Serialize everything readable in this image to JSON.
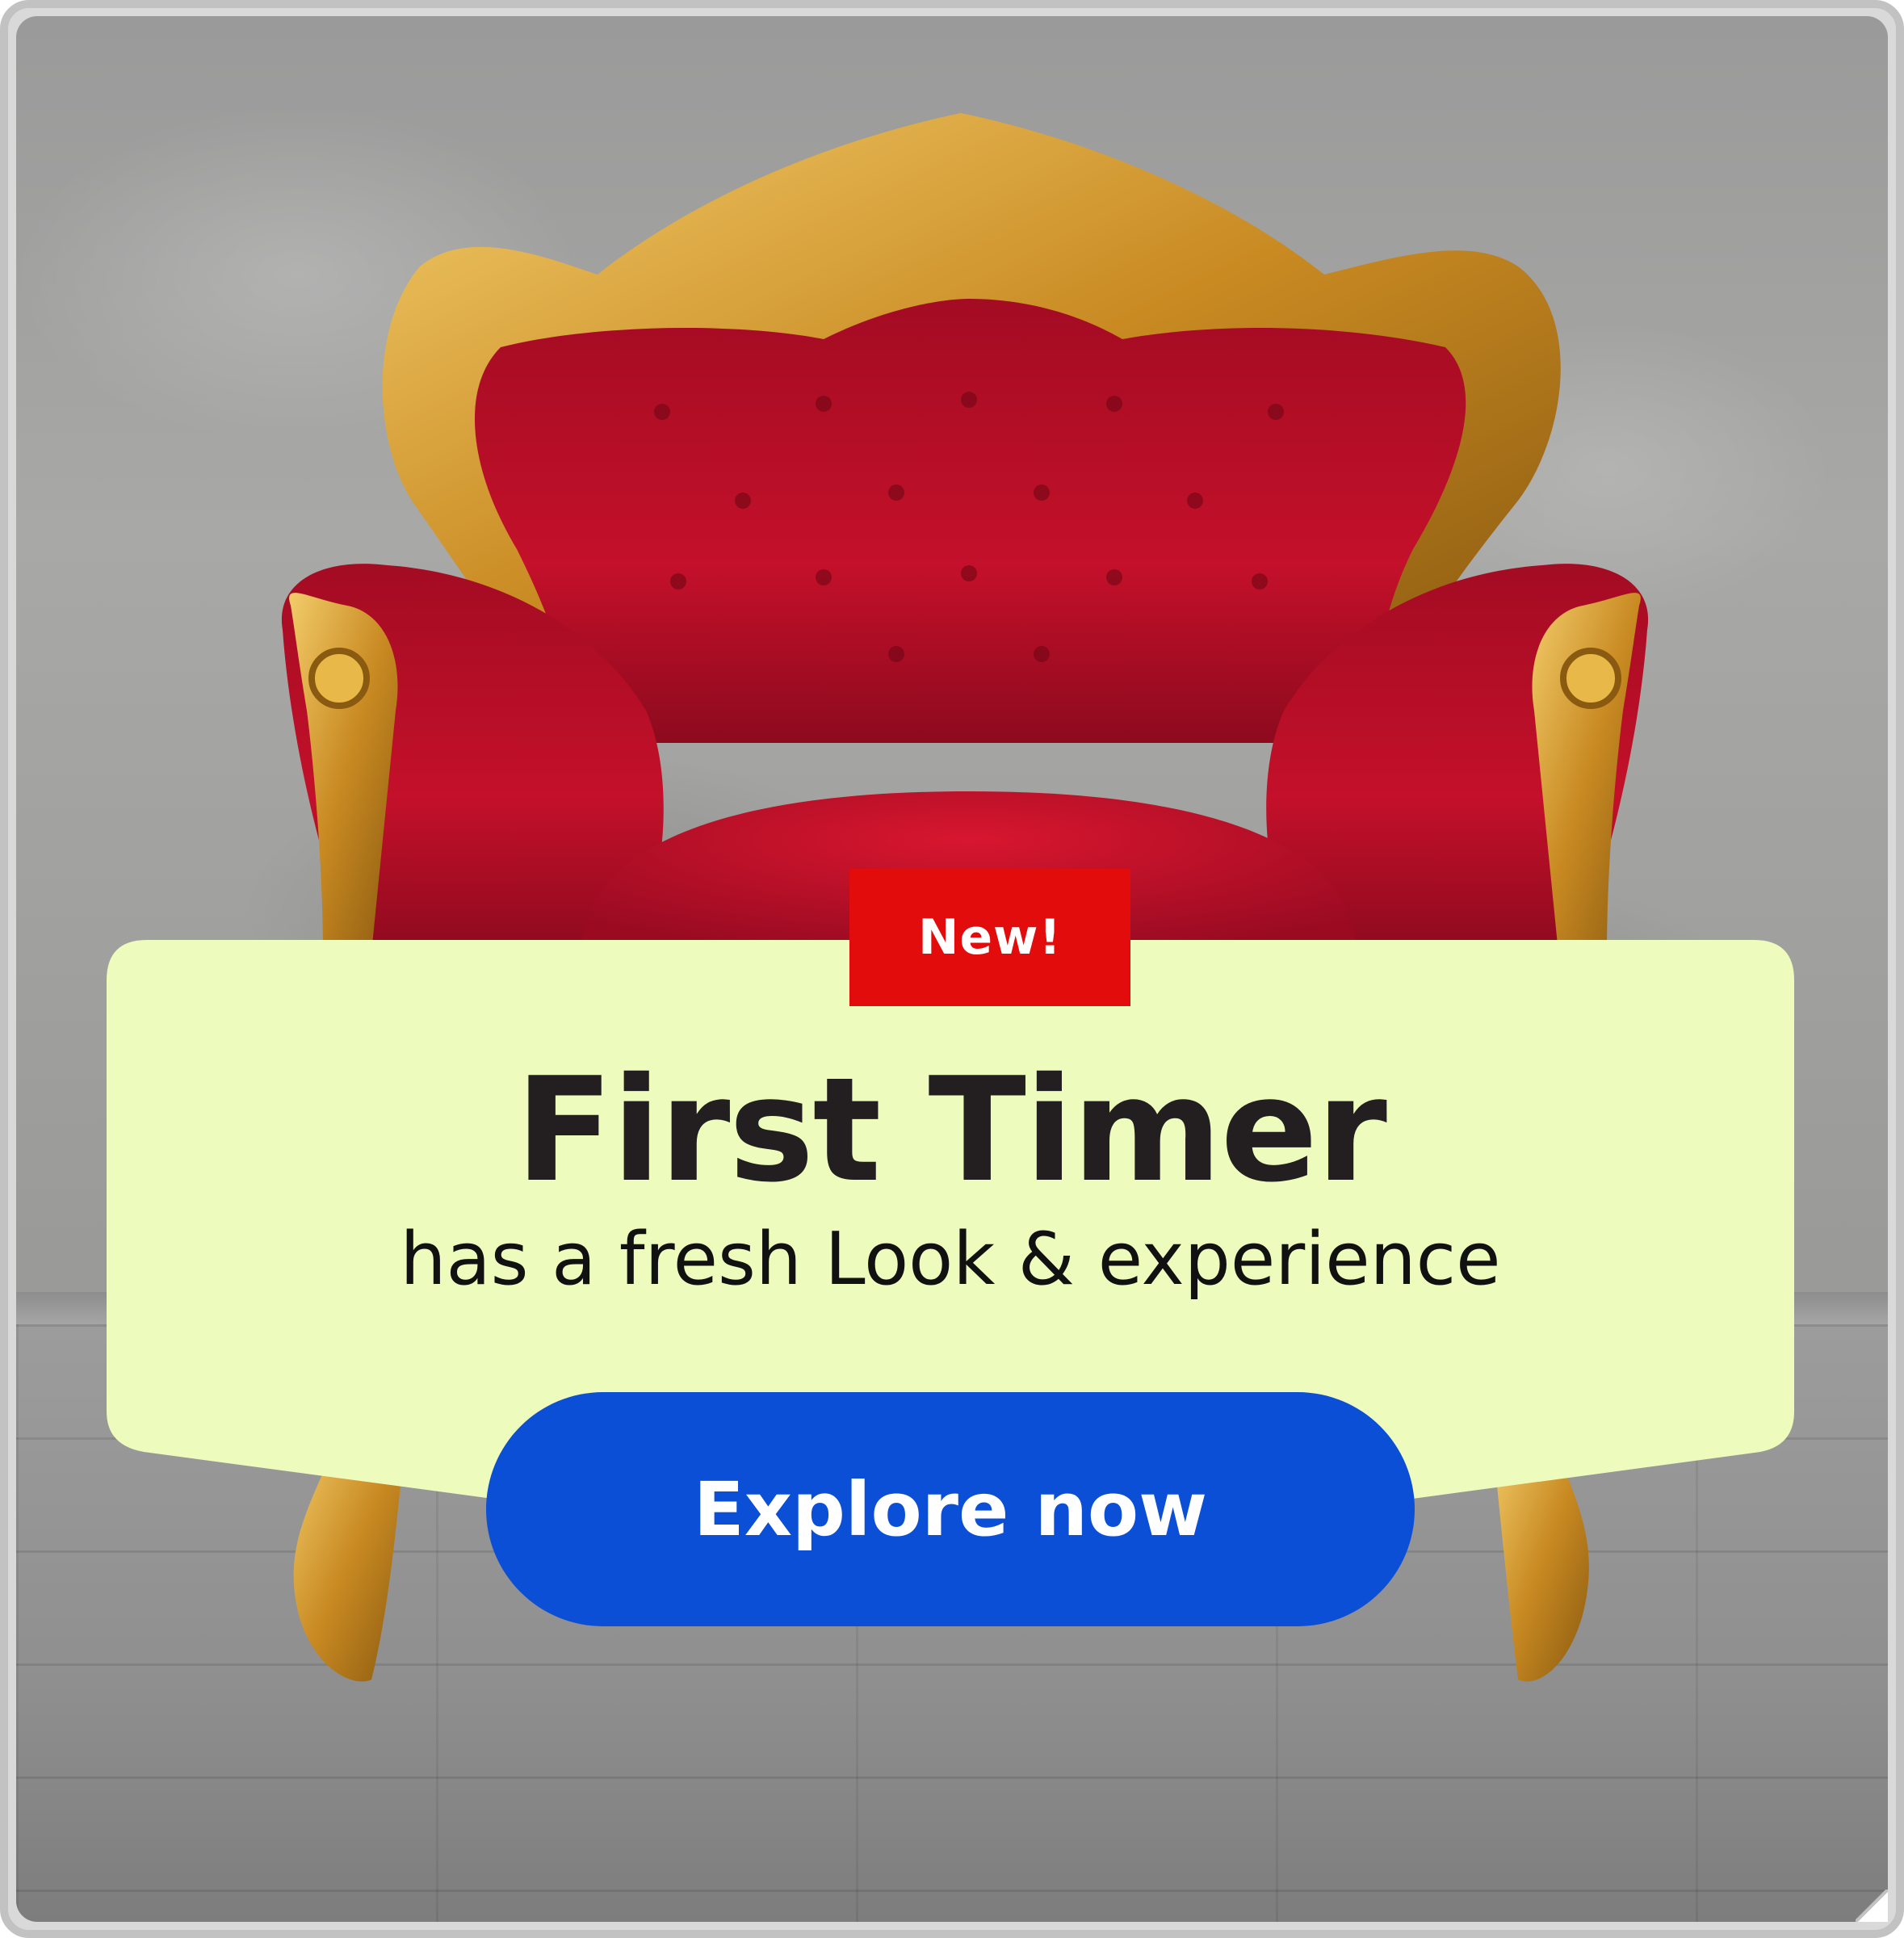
{
  "banner": {
    "badge_label": "New!",
    "title": "First Timer",
    "subtitle": "has a fresh Look & experience",
    "cta_label": "Explore now"
  },
  "colors": {
    "badge_bg": "#e30c0c",
    "card_bg": "#edfcbd",
    "cta_bg": "#0a4fd6",
    "title_text": "#231f20",
    "chair_red": "#c4102a",
    "chair_gold": "#d19a2c"
  },
  "icons": {
    "hero_image": "red-velvet-armchair-image"
  }
}
